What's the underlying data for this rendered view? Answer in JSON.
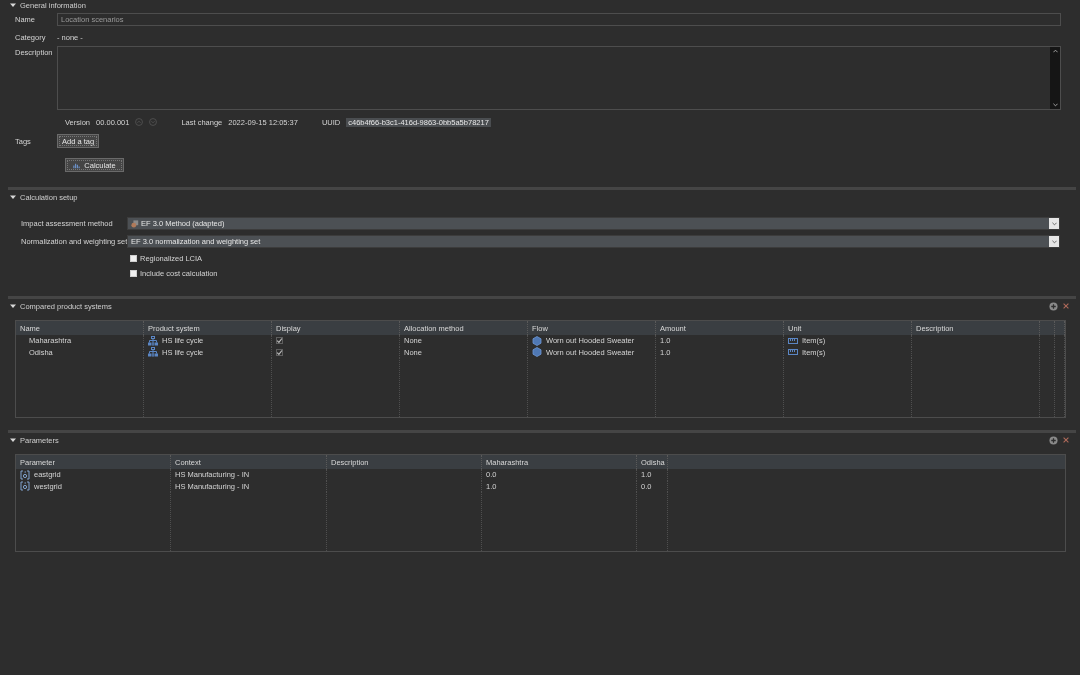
{
  "general_information": {
    "title": "General information",
    "expanded": true,
    "name_label": "Name",
    "name_value": "Location scenarios",
    "category_label": "Category",
    "category_value": "- none -",
    "description_label": "Description",
    "version_label": "Version",
    "version_value": "00.00.001",
    "last_change_label": "Last change",
    "last_change_value": "2022-09-15 12:05:37",
    "uuid_label": "UUID",
    "uuid_value": "c46b4f66-b3c1-416d-9863-0bb5a5b78217",
    "tags_label": "Tags",
    "add_tag_button": "Add a tag",
    "calculate_button": "Calculate"
  },
  "calculation_setup": {
    "title": "Calculation setup",
    "expanded": true,
    "impact_method_label": "Impact assessment method",
    "impact_method_value": "EF 3.0 Method (adapted)",
    "normalization_label": "Normalization and weighting set",
    "normalization_value": "EF 3.0 normalization and weighting set",
    "options": [
      {
        "label": "Regionalized LCIA",
        "checked": false
      },
      {
        "label": "Include cost calculation",
        "checked": false
      }
    ]
  },
  "compared_product_systems": {
    "title": "Compared product systems",
    "expanded": true,
    "columns": [
      "Name",
      "Product system",
      "Display",
      "Allocation method",
      "Flow",
      "Amount",
      "Unit",
      "Description"
    ],
    "rows": [
      {
        "name": "Maharashtra",
        "product_system": "HS life cycle",
        "display": true,
        "allocation_method": "None",
        "flow": "Worn out Hooded Sweater",
        "amount": "1.0",
        "unit": "Item(s)"
      },
      {
        "name": "Odisha",
        "product_system": "HS life cycle",
        "display": true,
        "allocation_method": "None",
        "flow": "Worn out Hooded Sweater",
        "amount": "1.0",
        "unit": "Item(s)"
      }
    ]
  },
  "parameters": {
    "title": "Parameters",
    "expanded": true,
    "columns": [
      "Parameter",
      "Context",
      "Description",
      "Maharashtra",
      "Odisha"
    ],
    "rows": [
      {
        "parameter": "eastgrid",
        "context": "HS Manufacturing - IN",
        "values": [
          "0.0",
          "1.0"
        ]
      },
      {
        "parameter": "westgrid",
        "context": "HS Manufacturing - IN",
        "values": [
          "1.0",
          "0.0"
        ]
      }
    ]
  }
}
